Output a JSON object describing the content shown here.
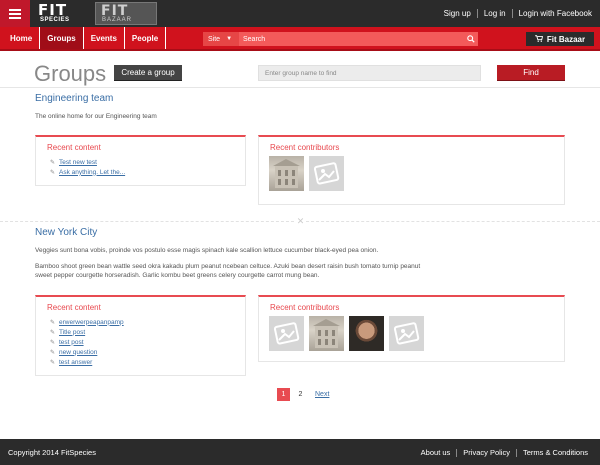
{
  "topbar": {
    "logo_fit_big": "FIT",
    "logo_fit_small": "SPECIES",
    "logo_bazaar_big": "FIT",
    "logo_bazaar_small": "BAZAAR",
    "links": [
      "Sign up",
      "Log in",
      "Login with Facebook"
    ]
  },
  "nav": {
    "items": [
      "Home",
      "Groups",
      "Events",
      "People"
    ],
    "active": "Groups",
    "search_scope": "Site",
    "search_placeholder": "Search",
    "fit_bazaar_label": "Fit Bazaar"
  },
  "header": {
    "title": "Groups",
    "create_label": "Create a group",
    "find_placeholder": "Enter group name to find",
    "find_label": "Find"
  },
  "groups": [
    {
      "name": "Engineering team",
      "description": [
        "The online home for our Engineering team"
      ],
      "recent_content_title": "Recent content",
      "recent_content": [
        "Test new test",
        "Ask anything. Let the..."
      ],
      "recent_contributors_title": "Recent contributors",
      "contributors": [
        "building",
        "placeholder"
      ]
    },
    {
      "name": "New York City",
      "description": [
        "Veggies sunt bona vobis, proinde vos postulo esse magis spinach kale scallion lettuce cucumber black-eyed pea onion.",
        "Bamboo shoot green bean wattle seed okra kakadu plum peanut ncebean celtuce. Azuki bean desert raisin bush tomato turnip peanut sweet pepper courgette horseradish. Garlic kombu beet greens celery courgette carrot mung bean."
      ],
      "recent_content_title": "Recent content",
      "recent_content": [
        "erwerwerpeapanpamp",
        "Title post",
        "test post",
        "new question",
        "test answer"
      ],
      "recent_contributors_title": "Recent contributors",
      "contributors": [
        "placeholder",
        "building",
        "face",
        "placeholder"
      ]
    }
  ],
  "pagination": {
    "pages": [
      "1",
      "2"
    ],
    "current": "1",
    "next_label": "Next"
  },
  "footer": {
    "copyright": "Copyright 2014 FitSpecies",
    "links": [
      "About us",
      "Privacy Policy",
      "Terms & Conditions"
    ]
  },
  "colors": {
    "brand_red": "#d0121d",
    "accent_red": "#e84b51",
    "dark": "#2b2b2b",
    "link_blue": "#3a6ea5"
  }
}
